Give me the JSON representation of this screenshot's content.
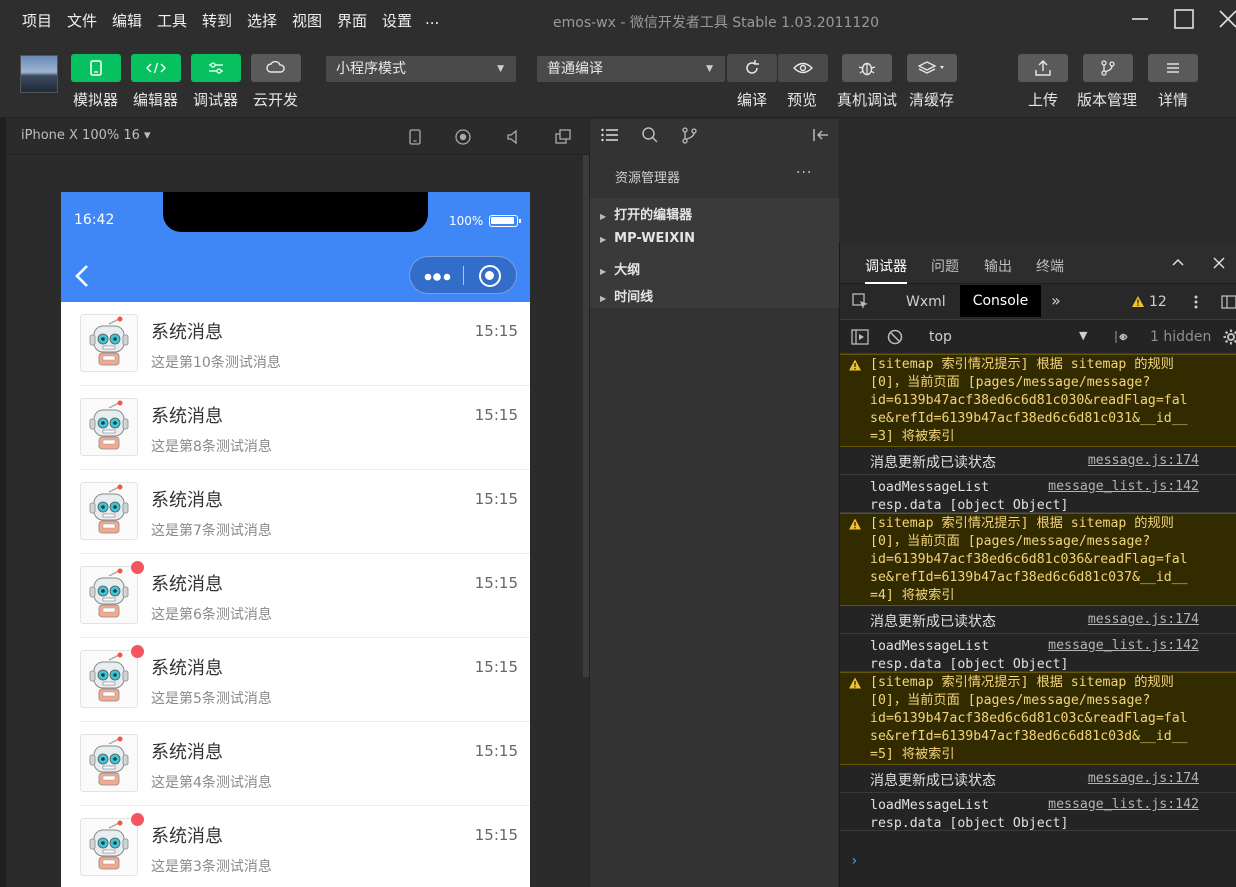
{
  "window": {
    "title": "emos-wx - 微信开发者工具 Stable 1.03.2011120"
  },
  "menu": [
    "项目",
    "文件",
    "编辑",
    "工具",
    "转到",
    "选择",
    "视图",
    "界面",
    "设置",
    "..."
  ],
  "toolbar": {
    "simulator": "模拟器",
    "editor": "编辑器",
    "debugger": "调试器",
    "cloud": "云开发",
    "mode_select": "小程序模式",
    "compile_select": "普通编译",
    "compile": "编译",
    "preview": "预览",
    "real_debug": "真机调试",
    "clear_cache": "清缓存",
    "upload": "上传",
    "version": "版本管理",
    "details": "详情",
    "accent_green": "#07c160"
  },
  "simulator": {
    "device": "iPhone X 100% 16 ▾"
  },
  "phone": {
    "time": "16:42",
    "battery": "100%",
    "header_color": "#3f86f7",
    "messages": [
      {
        "title": "系统消息",
        "time": "15:15",
        "sub": "这是第10条测试消息",
        "unread": false
      },
      {
        "title": "系统消息",
        "time": "15:15",
        "sub": "这是第8条测试消息",
        "unread": false
      },
      {
        "title": "系统消息",
        "time": "15:15",
        "sub": "这是第7条测试消息",
        "unread": false
      },
      {
        "title": "系统消息",
        "time": "15:15",
        "sub": "这是第6条测试消息",
        "unread": true
      },
      {
        "title": "系统消息",
        "time": "15:15",
        "sub": "这是第5条测试消息",
        "unread": true
      },
      {
        "title": "系统消息",
        "time": "15:15",
        "sub": "这是第4条测试消息",
        "unread": false
      },
      {
        "title": "系统消息",
        "time": "15:15",
        "sub": "这是第3条测试消息",
        "unread": true
      }
    ]
  },
  "explorer": {
    "title": "资源管理器",
    "more": "···",
    "tree": [
      "打开的编辑器",
      "MP-WEIXIN",
      "大纲",
      "时间线"
    ]
  },
  "debugger": {
    "tabs": [
      "调试器",
      "问题",
      "输出",
      "终端"
    ],
    "dev_tabs": {
      "wxml": "Wxml",
      "console": "Console",
      "more": "»",
      "warn_count": "12"
    },
    "context": "top",
    "hidden": "1 hidden",
    "prompt": "›",
    "logs": [
      {
        "type": "warn",
        "text": "[sitemap 索引情况提示] 根据 sitemap 的规则\n[0]，当前页面 [pages/message/message?\nid=6139b47acf38ed6c6d81c030&readFlag=fal\nse&refId=6139b47acf38ed6c6d81c031&__id__\n=3] 将被索引"
      },
      {
        "type": "info",
        "text": "消息更新成已读状态",
        "src": "message.js:174"
      },
      {
        "type": "info2",
        "text": "loadMessageList\nresp.data [object Object]",
        "src": "message_list.js:142"
      },
      {
        "type": "warn",
        "text": "[sitemap 索引情况提示] 根据 sitemap 的规则\n[0]，当前页面 [pages/message/message?\nid=6139b47acf38ed6c6d81c036&readFlag=fal\nse&refId=6139b47acf38ed6c6d81c037&__id__\n=4] 将被索引"
      },
      {
        "type": "info",
        "text": "消息更新成已读状态",
        "src": "message.js:174"
      },
      {
        "type": "info2",
        "text": "loadMessageList\nresp.data [object Object]",
        "src": "message_list.js:142"
      },
      {
        "type": "warn",
        "text": "[sitemap 索引情况提示] 根据 sitemap 的规则\n[0]，当前页面 [pages/message/message?\nid=6139b47acf38ed6c6d81c03c&readFlag=fal\nse&refId=6139b47acf38ed6c6d81c03d&__id__\n=5] 将被索引"
      },
      {
        "type": "info",
        "text": "消息更新成已读状态",
        "src": "message.js:174"
      },
      {
        "type": "info2",
        "text": "loadMessageList\nresp.data [object Object]",
        "src": "message_list.js:142"
      }
    ]
  }
}
